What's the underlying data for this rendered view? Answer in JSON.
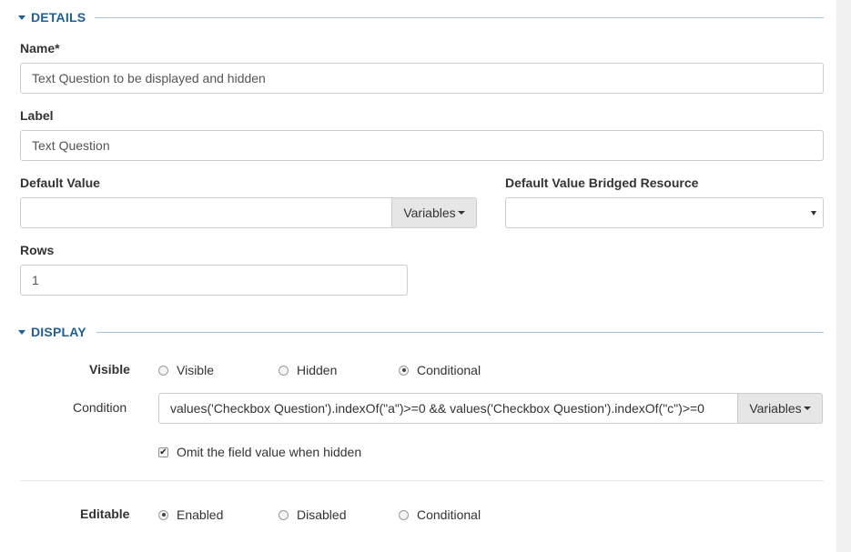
{
  "details": {
    "title": "DETAILS",
    "name_label": "Name*",
    "name_value": "Text Question to be displayed and hidden",
    "label_label": "Label",
    "label_value": "Text Question",
    "default_value_label": "Default Value",
    "default_value": "",
    "variables_label": "Variables",
    "bridged_label": "Default Value Bridged Resource",
    "bridged_value": "",
    "rows_label": "Rows",
    "rows_value": "1"
  },
  "display": {
    "title": "DISPLAY",
    "visible_label": "Visible",
    "visible_options": [
      "Visible",
      "Hidden",
      "Conditional"
    ],
    "visible_selected": "Conditional",
    "condition_label": "Condition",
    "condition_value": "values('Checkbox Question').indexOf(\"a\")>=0 && values('Checkbox Question').indexOf(\"c\")>=0",
    "variables_label": "Variables",
    "omit_label": "Omit the field value when hidden",
    "omit_checked": true,
    "editable_label": "Editable",
    "editable_options": [
      "Enabled",
      "Disabled",
      "Conditional"
    ],
    "editable_selected": "Enabled"
  }
}
